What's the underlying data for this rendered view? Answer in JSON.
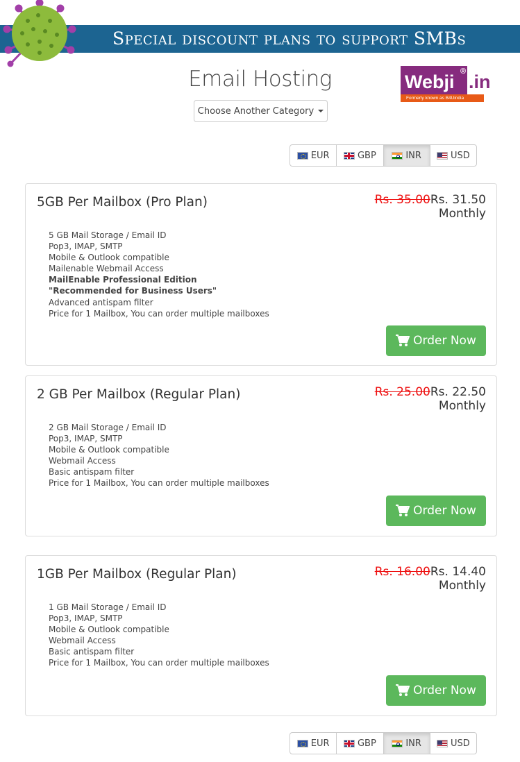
{
  "banner": {
    "text": "Special discount plans to support SMBs"
  },
  "logo": {
    "word": "Webji",
    "reg": "®",
    "suffix": ".in",
    "tagline": "Formerly known as B4Uindia"
  },
  "page": {
    "title": "Email Hosting",
    "category_button": "Choose Another Category"
  },
  "currencies": [
    {
      "code": "EUR",
      "flag": "eu-flag-icon"
    },
    {
      "code": "GBP",
      "flag": "gb-flag-icon"
    },
    {
      "code": "INR",
      "flag": "in-flag-icon",
      "active": true
    },
    {
      "code": "USD",
      "flag": "us-flag-icon"
    }
  ],
  "plans": [
    {
      "name": "5GB Per Mailbox (Pro Plan)",
      "old_price": "Rs. 35.00",
      "new_price": "Rs. 31.50",
      "period": "Monthly",
      "features": [
        "5 GB Mail Storage / Email ID",
        "Pop3, IMAP, SMTP",
        "Mobile & Outlook compatible",
        "Mailenable Webmail Access",
        "MailEnable Professional Edition",
        "\"Recommended for Business Users\"",
        "Advanced antispam filter",
        "Price for 1 Mailbox, You can order multiple mailboxes"
      ],
      "order_label": "Order Now"
    },
    {
      "name": "2 GB Per Mailbox (Regular Plan)",
      "old_price": "Rs. 25.00",
      "new_price": "Rs. 22.50",
      "period": "Monthly",
      "features": [
        "2 GB Mail Storage / Email ID",
        "Pop3, IMAP, SMTP",
        "Mobile & Outlook compatible",
        "Webmail Access",
        "Basic antispam filter",
        "Price for 1 Mailbox, You can order multiple mailboxes"
      ],
      "order_label": "Order Now"
    },
    {
      "name": "1GB Per Mailbox (Regular Plan)",
      "old_price": "Rs. 16.00",
      "new_price": "Rs. 14.40",
      "period": "Monthly",
      "features": [
        "1 GB Mail Storage / Email ID",
        "Pop3, IMAP, SMTP",
        "Mobile & Outlook compatible",
        "Webmail Access",
        "Basic antispam filter",
        "Price for 1 Mailbox, You can order multiple mailboxes"
      ],
      "order_label": "Order Now"
    }
  ],
  "colors": {
    "banner": "#1c6491",
    "order_button": "#5cb85c",
    "old_price": "#ee1111",
    "logo_purple": "#862b7e",
    "logo_orange": "#e85a17"
  }
}
